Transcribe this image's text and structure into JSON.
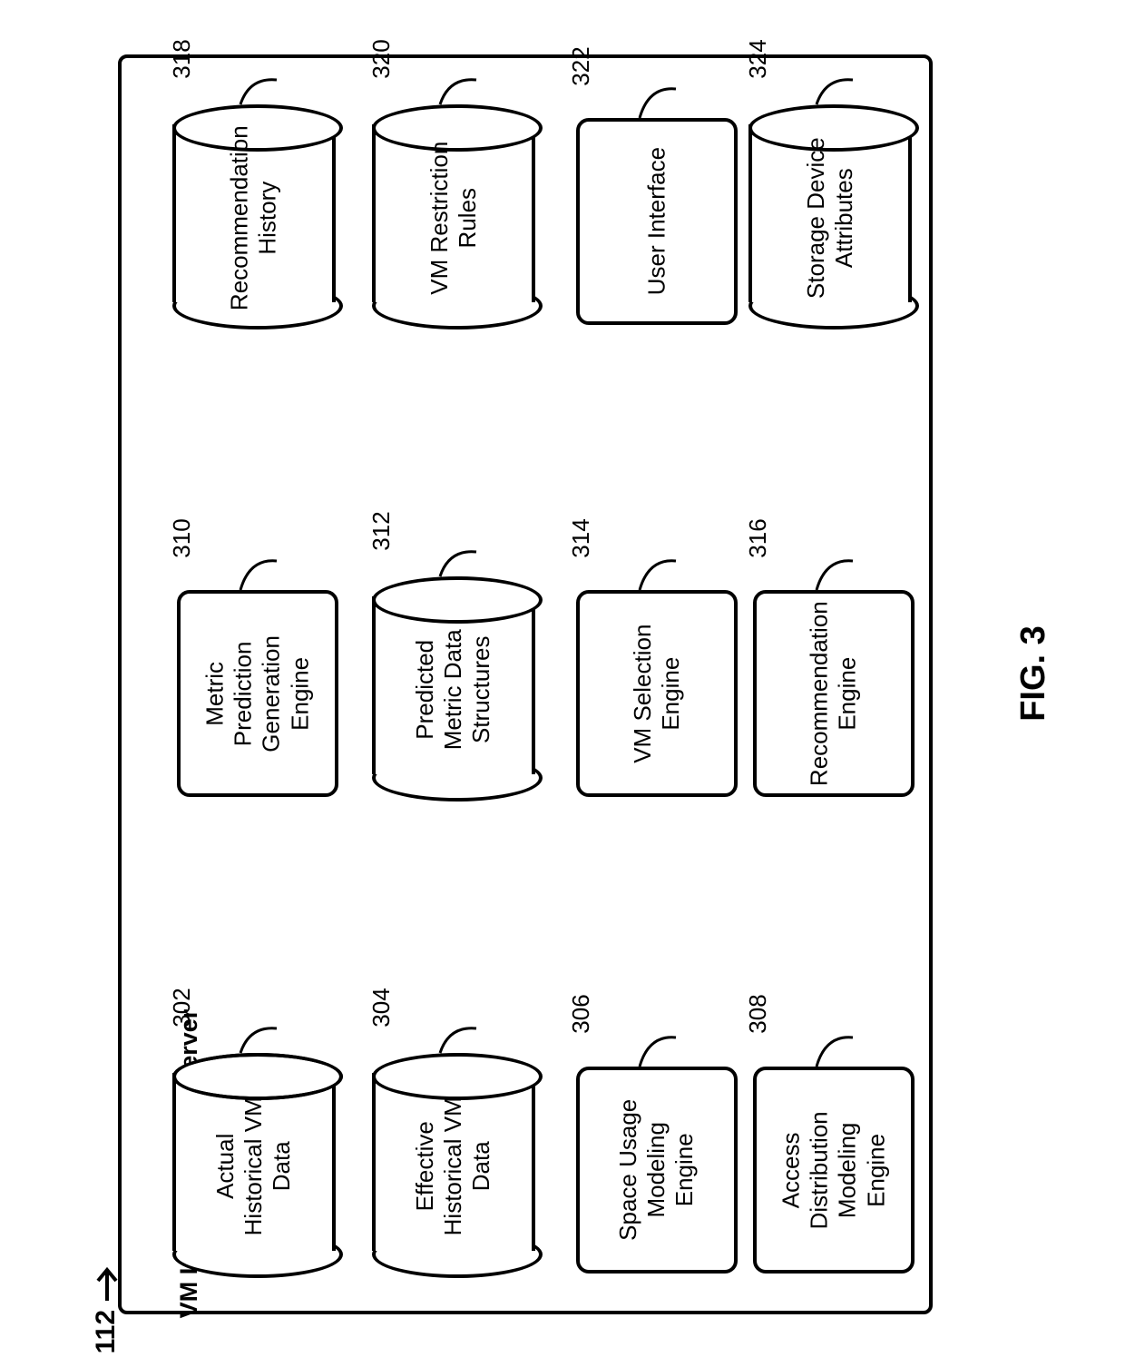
{
  "outer_ref": "112",
  "server_title": "VM Load Balancing Server",
  "figure_label": "FIG. 3",
  "items": {
    "c302": {
      "ref": "302",
      "label": "Actual Historical VM Data"
    },
    "c304": {
      "ref": "304",
      "label": "Effective Historical VM Data"
    },
    "c306": {
      "ref": "306",
      "label": "Space Usage Modeling Engine"
    },
    "c308": {
      "ref": "308",
      "label": "Access Distribution Modeling Engine"
    },
    "c310": {
      "ref": "310",
      "label": "Metric Prediction Generation Engine"
    },
    "c312": {
      "ref": "312",
      "label": "Predicted Metric Data Structures"
    },
    "c314": {
      "ref": "314",
      "label": "VM Selection Engine"
    },
    "c316": {
      "ref": "316",
      "label": "Recommendation Engine"
    },
    "c318": {
      "ref": "318",
      "label": "Recommendation History"
    },
    "c320": {
      "ref": "320",
      "label": "VM Restriction Rules"
    },
    "c322": {
      "ref": "322",
      "label": "User Interface"
    },
    "c324": {
      "ref": "324",
      "label": "Storage Device Attributes"
    }
  }
}
